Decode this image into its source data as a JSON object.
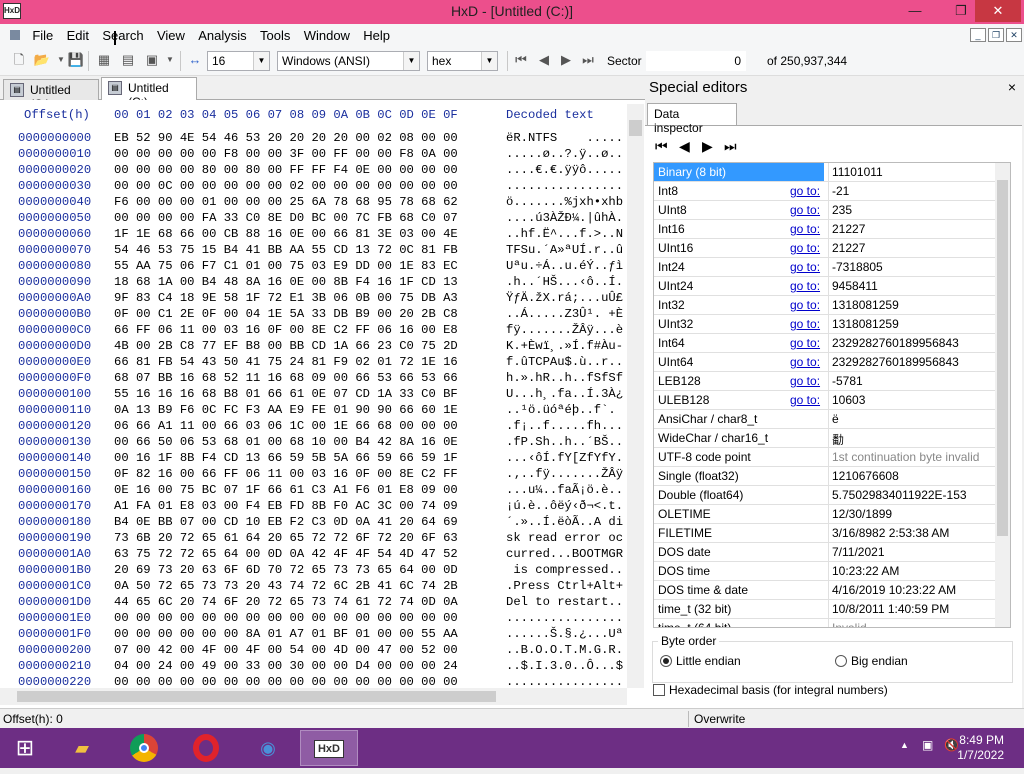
{
  "window": {
    "title": "HxD - [Untitled (C:)]",
    "logo": "HxD",
    "minimize": "—",
    "restore": "❐",
    "close": "✕"
  },
  "menu": [
    "File",
    "Edit",
    "Search",
    "View",
    "Analysis",
    "Tools",
    "Window",
    "Help"
  ],
  "toolbar": {
    "bytes_per_row": "16",
    "charset": "Windows (ANSI)",
    "offset_base": "hex",
    "sector_label": "Sector",
    "sector_value": "0",
    "sector_of": "of 250,937,344"
  },
  "tabs": [
    {
      "label": "Untitled (C:)"
    },
    {
      "label": "Untitled (C:)"
    }
  ],
  "hex": {
    "offset_header": "Offset(h)",
    "col_header": "00 01 02 03 04 05 06 07 08 09 0A 0B 0C 0D 0E 0F",
    "decoded_header": "Decoded text",
    "rows": [
      {
        "o": "0000000000",
        "h": "EB 52 90 4E 54 46 53 20 20 20 20 00 02 08 00 00",
        "d": "ëR.NTFS    ....."
      },
      {
        "o": "0000000010",
        "h": "00 00 00 00 00 F8 00 00 3F 00 FF 00 00 F8 0A 00",
        "d": ".....ø..?.ÿ..ø.."
      },
      {
        "o": "0000000020",
        "h": "00 00 00 00 80 00 80 00 FF FF F4 0E 00 00 00 00",
        "d": "....€.€.ÿÿô....."
      },
      {
        "o": "0000000030",
        "h": "00 00 0C 00 00 00 00 00 02 00 00 00 00 00 00 00",
        "d": "................"
      },
      {
        "o": "0000000040",
        "h": "F6 00 00 00 01 00 00 00 25 6A 78 68 95 78 68 62",
        "d": "ö.......%jxh•xhb"
      },
      {
        "o": "0000000050",
        "h": "00 00 00 00 FA 33 C0 8E D0 BC 00 7C FB 68 C0 07",
        "d": "....ú3ÀŽÐ¼.|ûhÀ."
      },
      {
        "o": "0000000060",
        "h": "1F 1E 68 66 00 CB 88 16 0E 00 66 81 3E 03 00 4E",
        "d": "..hf.Ë^...f.>..N"
      },
      {
        "o": "0000000070",
        "h": "54 46 53 75 15 B4 41 BB AA 55 CD 13 72 0C 81 FB",
        "d": "TFSu.´A»ªUÍ.r..û"
      },
      {
        "o": "0000000080",
        "h": "55 AA 75 06 F7 C1 01 00 75 03 E9 DD 00 1E 83 EC",
        "d": "Uªu.÷Á..u.éÝ..ƒì"
      },
      {
        "o": "0000000090",
        "h": "18 68 1A 00 B4 48 8A 16 0E 00 8B F4 16 1F CD 13",
        "d": ".h..´HŠ...‹ô..Í."
      },
      {
        "o": "00000000A0",
        "h": "9F 83 C4 18 9E 58 1F 72 E1 3B 06 0B 00 75 DB A3",
        "d": "ŸƒÄ.žX.rá;...uÛ£"
      },
      {
        "o": "00000000B0",
        "h": "0F 00 C1 2E 0F 00 04 1E 5A 33 DB B9 00 20 2B C8",
        "d": "..Á.....Z3Û¹. +È"
      },
      {
        "o": "00000000C0",
        "h": "66 FF 06 11 00 03 16 0F 00 8E C2 FF 06 16 00 E8",
        "d": "fÿ.......ŽÂÿ...è"
      },
      {
        "o": "00000000D0",
        "h": "4B 00 2B C8 77 EF B8 00 BB CD 1A 66 23 C0 75 2D",
        "d": "K.+Èwï¸.»Í.f#Àu-"
      },
      {
        "o": "00000000E0",
        "h": "66 81 FB 54 43 50 41 75 24 81 F9 02 01 72 1E 16",
        "d": "f.ûTCPAu$.ù..r.."
      },
      {
        "o": "00000000F0",
        "h": "68 07 BB 16 68 52 11 16 68 09 00 66 53 66 53 66",
        "d": "h.».hR..h..fSfSf"
      },
      {
        "o": "0000000100",
        "h": "55 16 16 16 68 B8 01 66 61 0E 07 CD 1A 33 C0 BF",
        "d": "U...h¸.fa..Í.3À¿"
      },
      {
        "o": "0000000110",
        "h": "0A 13 B9 F6 0C FC F3 AA E9 FE 01 90 90 66 60 1E",
        "d": "..¹ö.üóªéþ..f`."
      },
      {
        "o": "0000000120",
        "h": "06 66 A1 11 00 66 03 06 1C 00 1E 66 68 00 00 00",
        "d": ".f¡..f.....fh..."
      },
      {
        "o": "0000000130",
        "h": "00 66 50 06 53 68 01 00 68 10 00 B4 42 8A 16 0E",
        "d": ".fP.Sh..h..´BŠ.."
      },
      {
        "o": "0000000140",
        "h": "00 16 1F 8B F4 CD 13 66 59 5B 5A 66 59 66 59 1F",
        "d": "...‹ôÍ.fY[ZfYfY."
      },
      {
        "o": "0000000150",
        "h": "0F 82 16 00 66 FF 06 11 00 03 16 0F 00 8E C2 FF",
        "d": ".‚..fÿ.......ŽÂÿ"
      },
      {
        "o": "0000000160",
        "h": "0E 16 00 75 BC 07 1F 66 61 C3 A1 F6 01 E8 09 00",
        "d": "...u¼..faÃ¡ö.è.."
      },
      {
        "o": "0000000170",
        "h": "A1 FA 01 E8 03 00 F4 EB FD 8B F0 AC 3C 00 74 09",
        "d": "¡ú.è..ôëý‹ð¬<.t."
      },
      {
        "o": "0000000180",
        "h": "B4 0E BB 07 00 CD 10 EB F2 C3 0D 0A 41 20 64 69",
        "d": "´.»..Í.ëòÃ..A di"
      },
      {
        "o": "0000000190",
        "h": "73 6B 20 72 65 61 64 20 65 72 72 6F 72 20 6F 63",
        "d": "sk read error oc"
      },
      {
        "o": "00000001A0",
        "h": "63 75 72 72 65 64 00 0D 0A 42 4F 4F 54 4D 47 52",
        "d": "curred...BOOTMGR"
      },
      {
        "o": "00000001B0",
        "h": "20 69 73 20 63 6F 6D 70 72 65 73 73 65 64 00 0D",
        "d": " is compressed.."
      },
      {
        "o": "00000001C0",
        "h": "0A 50 72 65 73 73 20 43 74 72 6C 2B 41 6C 74 2B",
        "d": ".Press Ctrl+Alt+"
      },
      {
        "o": "00000001D0",
        "h": "44 65 6C 20 74 6F 20 72 65 73 74 61 72 74 0D 0A",
        "d": "Del to restart.."
      },
      {
        "o": "00000001E0",
        "h": "00 00 00 00 00 00 00 00 00 00 00 00 00 00 00 00",
        "d": "................"
      },
      {
        "o": "00000001F0",
        "h": "00 00 00 00 00 00 8A 01 A7 01 BF 01 00 00 55 AA",
        "d": "......Š.§.¿...Uª"
      },
      {
        "o": "0000000200",
        "h": "07 00 42 00 4F 00 4F 00 54 00 4D 00 47 00 52 00",
        "d": "..B.O.O.T.M.G.R."
      },
      {
        "o": "0000000210",
        "h": "04 00 24 00 49 00 33 00 30 00 00 D4 00 00 00 24",
        "d": "..$.I.3.0..Ô...$"
      },
      {
        "o": "0000000220",
        "h": "00 00 00 00 00 00 00 00 00 00 00 00 00 00 00 00",
        "d": "................"
      }
    ]
  },
  "special": {
    "title": "Special editors",
    "close": "×",
    "tab": "Data inspector",
    "nav": [
      "⏮",
      "◀",
      "▶",
      "⏭"
    ],
    "rows": [
      {
        "n": "Binary (8 bit)",
        "g": "",
        "v": "11101011",
        "sel": true
      },
      {
        "n": "Int8",
        "g": "go to:",
        "v": "-21"
      },
      {
        "n": "UInt8",
        "g": "go to:",
        "v": "235"
      },
      {
        "n": "Int16",
        "g": "go to:",
        "v": "21227"
      },
      {
        "n": "UInt16",
        "g": "go to:",
        "v": "21227"
      },
      {
        "n": "Int24",
        "g": "go to:",
        "v": "-7318805"
      },
      {
        "n": "UInt24",
        "g": "go to:",
        "v": "9458411"
      },
      {
        "n": "Int32",
        "g": "go to:",
        "v": "1318081259"
      },
      {
        "n": "UInt32",
        "g": "go to:",
        "v": "1318081259"
      },
      {
        "n": "Int64",
        "g": "go to:",
        "v": "2329282760189956843"
      },
      {
        "n": "UInt64",
        "g": "go to:",
        "v": "2329282760189956843"
      },
      {
        "n": "LEB128",
        "g": "go to:",
        "v": "-5781"
      },
      {
        "n": "ULEB128",
        "g": "go to:",
        "v": "10603"
      },
      {
        "n": "AnsiChar / char8_t",
        "g": "",
        "v": "ë"
      },
      {
        "n": "WideChar / char16_t",
        "g": "",
        "v": "勫"
      },
      {
        "n": "UTF-8 code point",
        "g": "",
        "v": "1st continuation byte invalid",
        "gray": true
      },
      {
        "n": "Single (float32)",
        "g": "",
        "v": "1210676608"
      },
      {
        "n": "Double (float64)",
        "g": "",
        "v": "5.75029834011922E-153"
      },
      {
        "n": "OLETIME",
        "g": "",
        "v": "12/30/1899"
      },
      {
        "n": "FILETIME",
        "g": "",
        "v": "3/16/8982 2:53:38 AM"
      },
      {
        "n": "DOS date",
        "g": "",
        "v": "7/11/2021"
      },
      {
        "n": "DOS time",
        "g": "",
        "v": "10:23:22 AM"
      },
      {
        "n": "DOS time & date",
        "g": "",
        "v": "4/16/2019 10:23:22 AM"
      },
      {
        "n": "time_t (32 bit)",
        "g": "",
        "v": "10/8/2011 1:40:59 PM"
      },
      {
        "n": "time_t (64 bit)",
        "g": "",
        "v": "Invalid",
        "gray": true
      }
    ],
    "byte_order": "Byte order",
    "little": "Little endian",
    "big": "Big endian",
    "hexbasis": "Hexadecimal basis (for integral numbers)"
  },
  "status": {
    "offset": "Offset(h): 0",
    "mode": "Overwrite"
  },
  "taskbar": {
    "time": "8:49 PM",
    "date": "1/7/2022"
  }
}
